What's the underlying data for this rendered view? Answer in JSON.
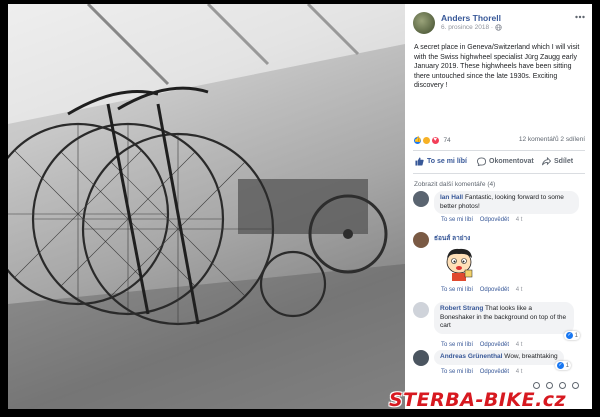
{
  "post": {
    "author": "Anders Thorell",
    "date": "6. prosince 2018 · ",
    "text": "A secret place in Geneva/Switzerland which I will visit with the Swiss highwheel specialist Jürg Zaugg early January 2019. These highwheels have been sitting there untouched since the late 1930s. Exciting discovery !",
    "more_icon": "horizontal-dots-icon"
  },
  "stats": {
    "reaction_count": "74",
    "comments": "12 komentářů",
    "shares": "2 sdílení"
  },
  "actions": {
    "like": "To se mi líbí",
    "comment": "Okomentovat",
    "share": "Sdílet"
  },
  "comments": {
    "more_label": "Zobrazit další komentáře (4)",
    "like_label": "To se mi líbí",
    "reply_label": "Odpovědět",
    "items": [
      {
        "name": "Ian Hall",
        "text": "Fantastic, looking forward to some better photos!",
        "time": "4 t"
      },
      {
        "name": "ธ่อนส์ ลาย่าง",
        "text": "",
        "time": "4 t"
      },
      {
        "name": "Robert Strang",
        "text": "That looks like a Boneshaker in the background on top of the cart",
        "time": "4 t",
        "likes": "1"
      },
      {
        "name": "Andreas Grünenthal",
        "text": "Wow, breathtaking",
        "time": "4 t",
        "likes": "1"
      }
    ]
  },
  "watermark": {
    "part1": "STERBA-",
    "part2": "BIKE.cz"
  },
  "colors": {
    "link": "#385898",
    "like_blue": "#1877f2",
    "watermark_red": "#d71920"
  }
}
